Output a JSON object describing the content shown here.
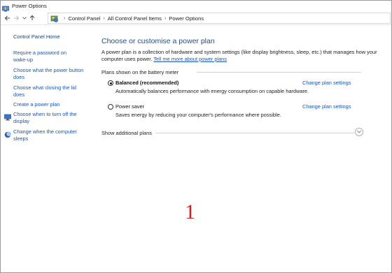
{
  "window": {
    "title": "Power Options"
  },
  "nav": {
    "back_icon": "back-arrow-icon",
    "forward_icon": "forward-arrow-icon",
    "recent_icon": "chevron-down-icon",
    "up_icon": "up-arrow-icon",
    "breadcrumbs": [
      "Control Panel",
      "All Control Panel Items",
      "Power Options"
    ],
    "separator": "›"
  },
  "sidebar": {
    "home": "Control Panel Home",
    "items": [
      {
        "label_line1": "Require a password on",
        "label_line2": "wake-up",
        "icon": null
      },
      {
        "label_line1": "Choose what the power button",
        "label_line2": "does",
        "icon": null
      },
      {
        "label_line1": "Choose what closing the lid",
        "label_line2": "does",
        "icon": null
      },
      {
        "label_line1": "Create a power plan",
        "label_line2": "",
        "icon": null
      },
      {
        "label_line1": "Choose when to turn off the",
        "label_line2": "display",
        "icon": "monitor-icon"
      },
      {
        "label_line1": "Change when the computer",
        "label_line2": "sleeps",
        "icon": "moon-icon"
      }
    ]
  },
  "main": {
    "heading": "Choose or customise a power plan",
    "description": "A power plan is a collection of hardware and system settings (like display brightness, sleep, etc.) that manages how your computer uses power.",
    "description_link": "Tell me more about power plans",
    "section_label": "Plans shown on the battery meter",
    "plans": [
      {
        "name": "Balanced (recommended)",
        "selected": true,
        "description": "Automatically balances performance with energy consumption on capable hardware.",
        "link": "Change plan settings"
      },
      {
        "name": "Power saver",
        "selected": false,
        "description": "Saves energy by reducing your computer's performance where possible.",
        "link": "Change plan settings"
      }
    ],
    "additional_plans_label": "Show additional plans",
    "expand_icon": "chevron-down-circle-icon"
  },
  "overlay": {
    "number": "1",
    "color": "#d21f1f"
  },
  "colors": {
    "link": "#1a56b8",
    "heading": "#1c4e9a"
  }
}
